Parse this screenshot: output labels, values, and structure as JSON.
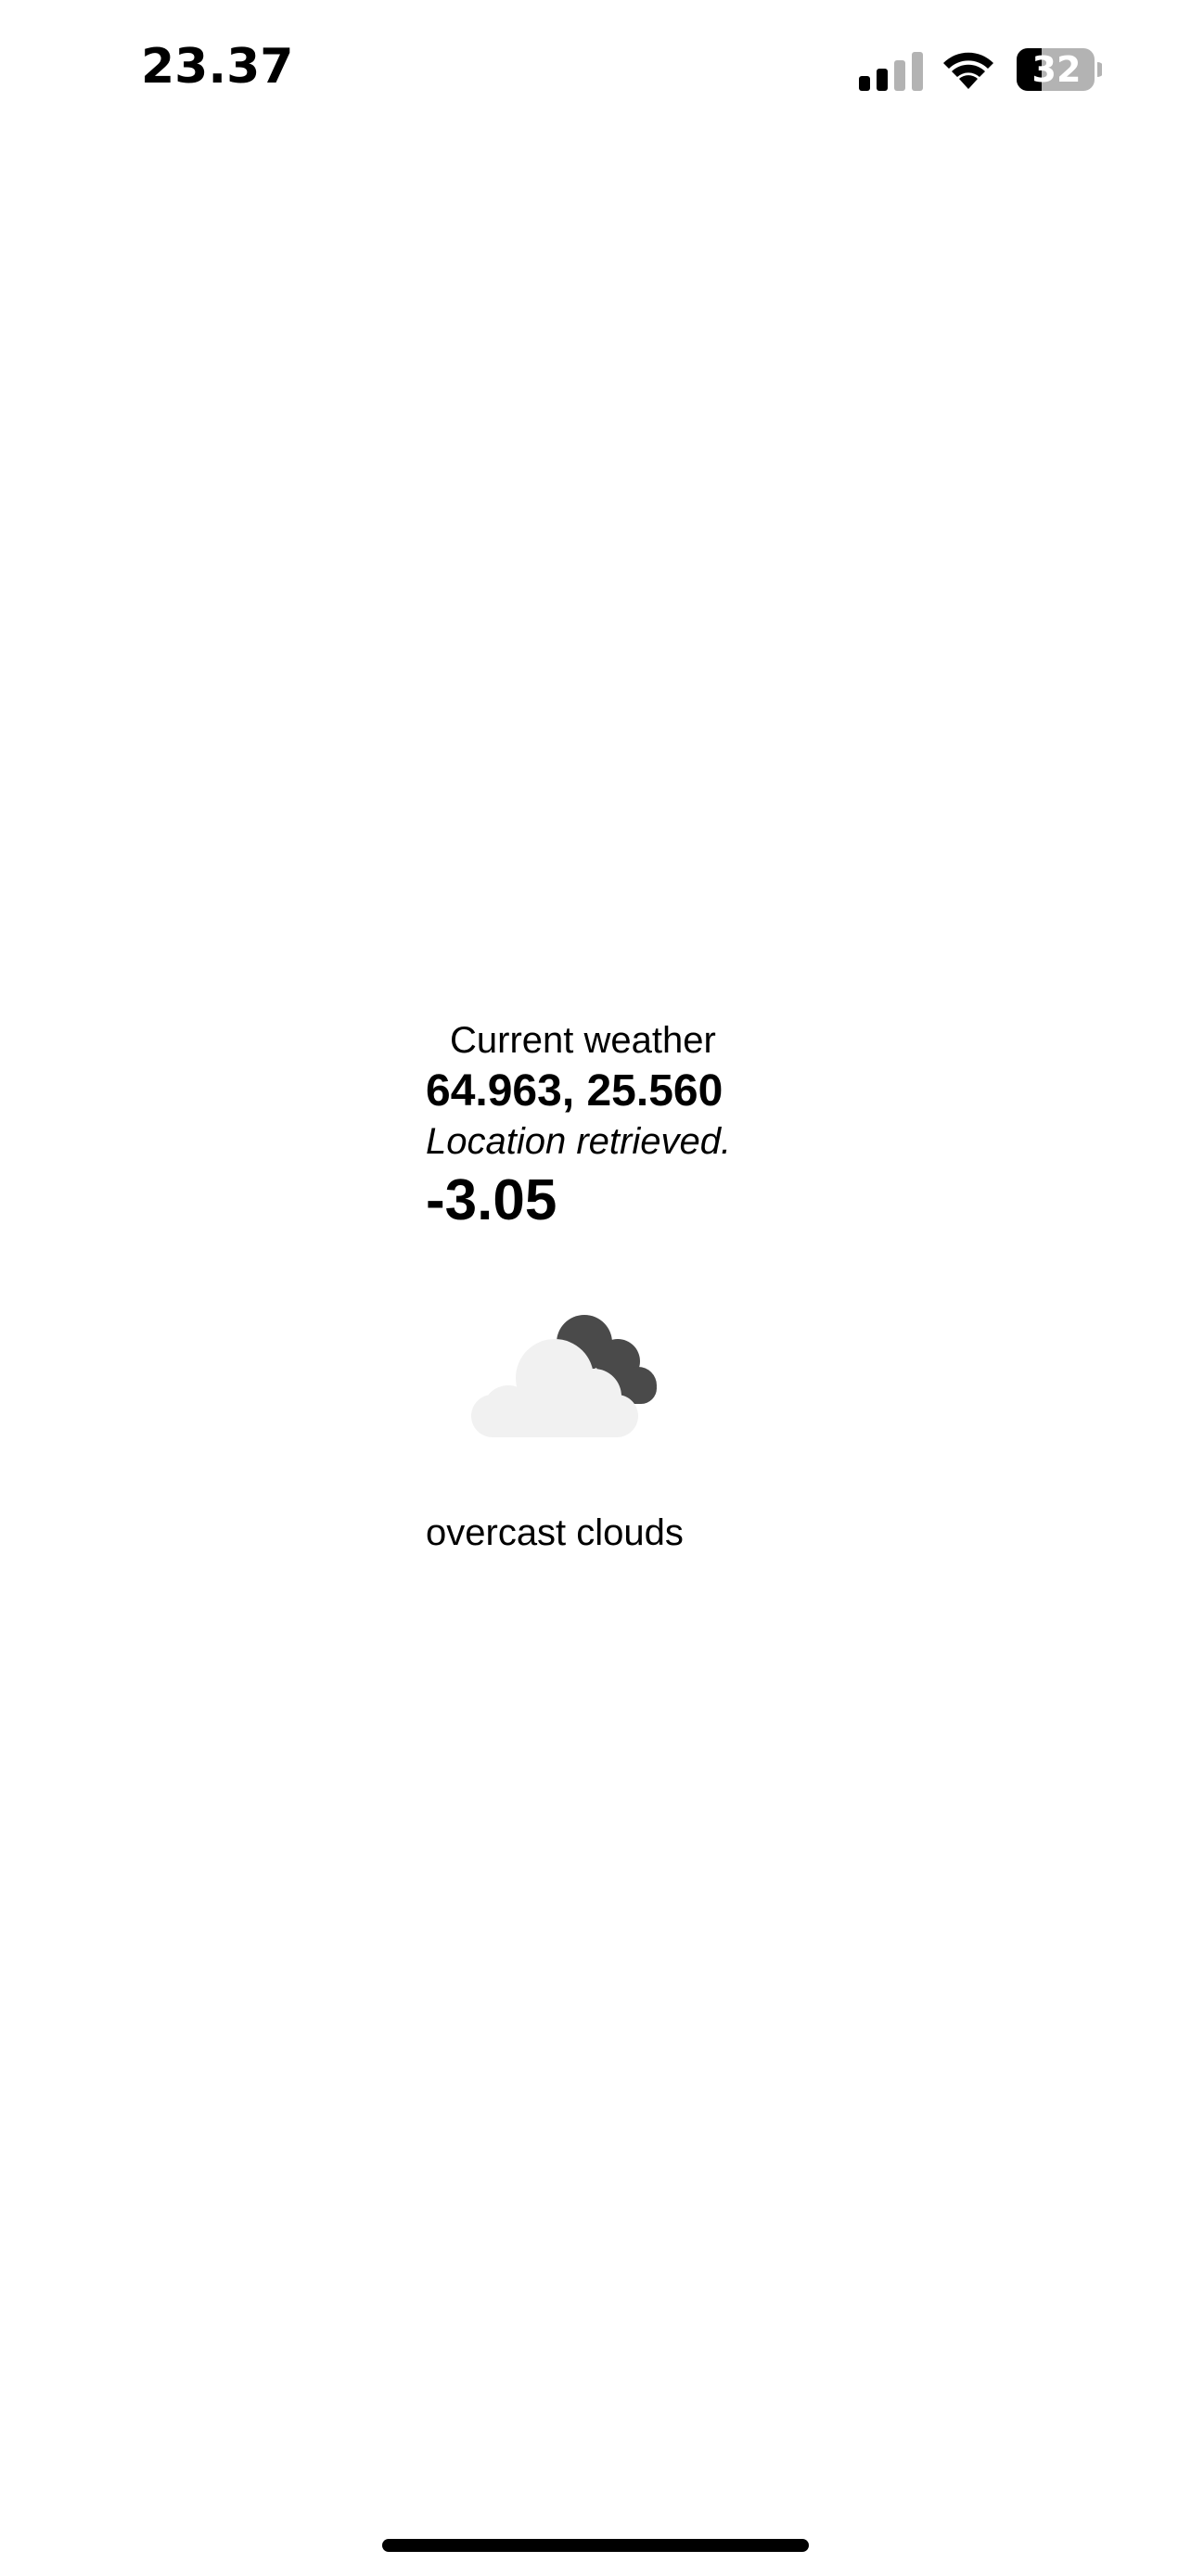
{
  "status_bar": {
    "time": "23.37",
    "battery_level": "32",
    "icons": [
      "cellular-signal-icon",
      "wifi-icon",
      "battery-icon"
    ]
  },
  "weather": {
    "heading": "Current weather",
    "coordinates": "64.963, 25.560",
    "location_status": "Location retrieved.",
    "temperature": "-3.05",
    "icon": "overcast-clouds-icon",
    "description": "overcast clouds"
  },
  "colors": {
    "background": "#ffffff",
    "text": "#000000",
    "cloud_light": "#f1f1f1",
    "cloud_dark": "#4a4a4a",
    "battery_fill": "#000000",
    "battery_empty": "#b3b3b3"
  }
}
